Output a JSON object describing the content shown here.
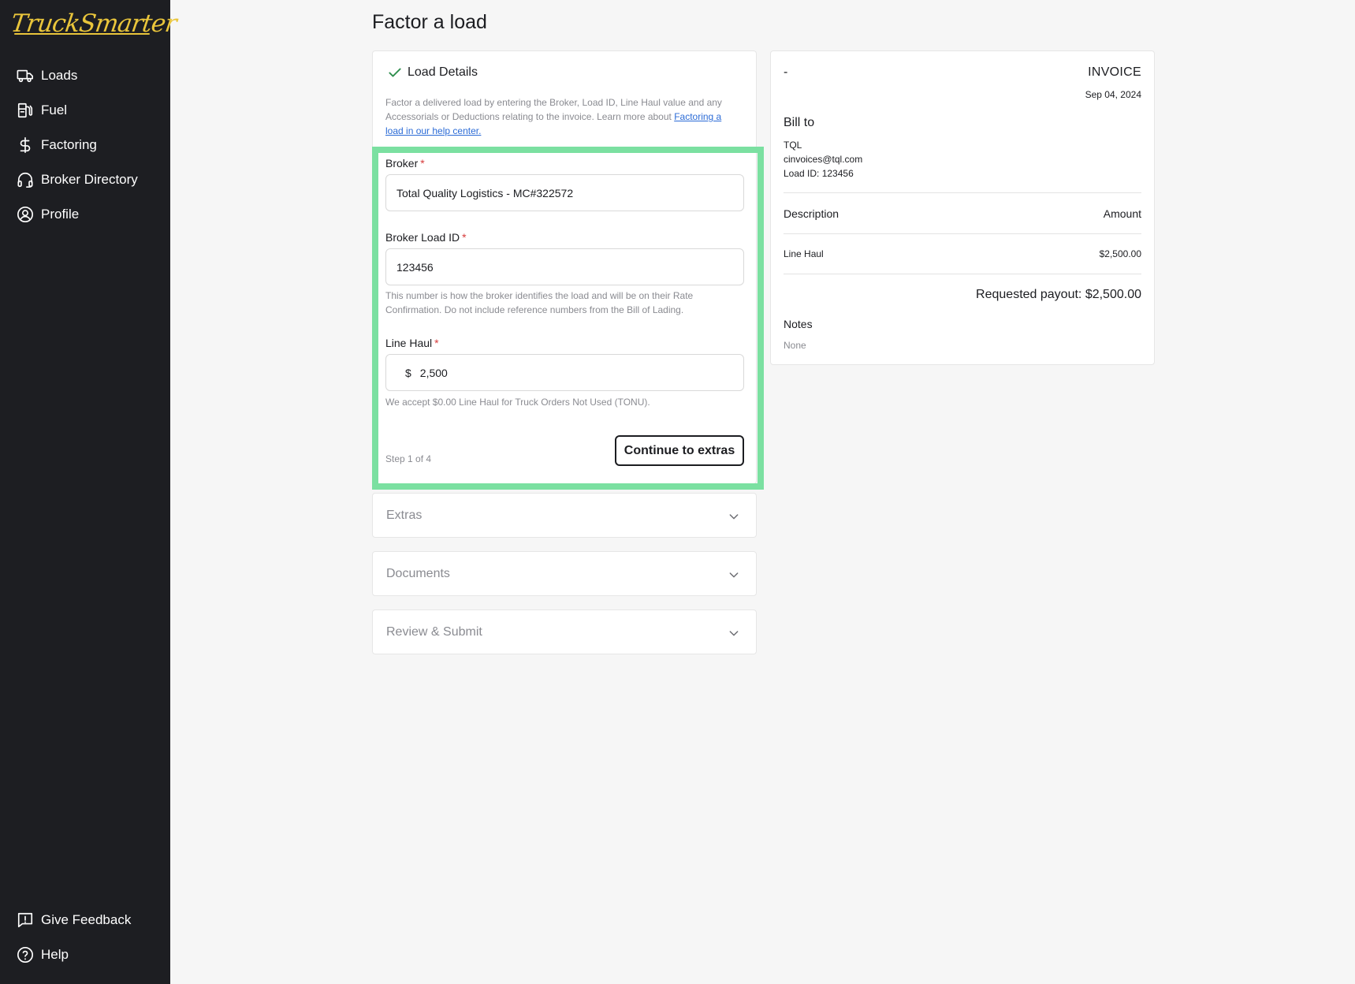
{
  "brand": {
    "name": "TruckSmarter",
    "logo_color": "#e9c53b"
  },
  "sidebar": {
    "items": [
      {
        "label": "Loads",
        "icon": "truck-icon"
      },
      {
        "label": "Fuel",
        "icon": "fuel-pump-icon"
      },
      {
        "label": "Factoring",
        "icon": "dollar-icon"
      },
      {
        "label": "Broker Directory",
        "icon": "headset-icon"
      },
      {
        "label": "Profile",
        "icon": "user-circle-icon"
      }
    ],
    "bottom_items": [
      {
        "label": "Give Feedback",
        "icon": "feedback-icon"
      },
      {
        "label": "Help",
        "icon": "help-circle-icon"
      }
    ]
  },
  "page": {
    "title": "Factor a load"
  },
  "load_details": {
    "title": "Load Details",
    "description": "Factor a delivered load by entering the Broker, Load ID, Line Haul value and any Accessorials or Deductions relating to the invoice. Learn more about ",
    "link_text": "Factoring a load in our help center.",
    "broker": {
      "label": "Broker",
      "required": "*",
      "value": "Total Quality Logistics - MC#322572"
    },
    "broker_load_id": {
      "label": "Broker Load ID",
      "required": "*",
      "value": "123456",
      "help": "This number is how the broker identifies the load and will be on their Rate Confirmation. Do not include reference numbers from the Bill of Lading."
    },
    "line_haul": {
      "label": "Line Haul",
      "required": "*",
      "currency": "$",
      "value": "2,500",
      "help": "We accept $0.00 Line Haul for Truck Orders Not Used (TONU)."
    },
    "step": "Step 1 of 4",
    "continue_label": "Continue to extras"
  },
  "accordions": [
    {
      "label": "Extras"
    },
    {
      "label": "Documents"
    },
    {
      "label": "Review & Submit"
    }
  ],
  "invoice": {
    "number": "-",
    "title": "INVOICE",
    "date": "Sep 04, 2024",
    "bill_to_label": "Bill to",
    "bill_to_name": "TQL",
    "bill_to_email": "cinvoices@tql.com",
    "load_id": "Load ID: 123456",
    "desc_header": "Description",
    "amount_header": "Amount",
    "items": [
      {
        "description": "Line Haul",
        "amount": "$2,500.00"
      }
    ],
    "payout": "Requested payout: $2,500.00",
    "notes_label": "Notes",
    "notes_value": "None"
  },
  "colors": {
    "highlight": "#7be0a1",
    "sidebar_bg": "#1d1e22",
    "link": "#2b6bd6",
    "required": "#d63b3b"
  }
}
